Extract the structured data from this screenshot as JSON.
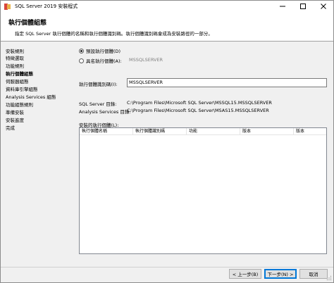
{
  "window": {
    "title": "SQL Server 2019 安裝程式",
    "minimize_symbol": "—",
    "maximize_symbol": "☐",
    "close_symbol": "✕"
  },
  "header": {
    "title": "執行個體組態",
    "description": "指定 SQL Server 執行個體的名稱和執行個體識別碼。執行個體識別碼會成為安裝路徑的一部分。"
  },
  "sidebar": {
    "items": [
      {
        "label": "安裝規則",
        "active": false
      },
      {
        "label": "特徵選取",
        "active": false
      },
      {
        "label": "功能規則",
        "active": false
      },
      {
        "label": "執行個體組態",
        "active": true
      },
      {
        "label": "伺服器組態",
        "active": false
      },
      {
        "label": "資料庫引擎組態",
        "active": false
      },
      {
        "label": "Analysis Services 組態",
        "active": false
      },
      {
        "label": "功能組態規則",
        "active": false
      },
      {
        "label": "準備安裝",
        "active": false
      },
      {
        "label": "安裝進度",
        "active": false
      },
      {
        "label": "完成",
        "active": false
      }
    ]
  },
  "instance": {
    "default_label": "預設執行個體(D)",
    "named_label": "具名執行個體(A):",
    "named_placeholder": "MSSQLSERVER",
    "selected": "default",
    "id_label": "執行個體識別碼(I):",
    "id_value": "MSSQLSERVER"
  },
  "paths": {
    "sql_label": "SQL Server 目錄:",
    "sql_value": "C:\\Program Files\\Microsoft SQL Server\\MSSQL15.MSSQLSERVER",
    "as_label": "Analysis Services 目錄:",
    "as_value": "C:\\Program Files\\Microsoft SQL Server\\MSAS15.MSSQLSERVER"
  },
  "installed": {
    "label": "安裝的執行個體(L):",
    "columns": [
      "執行個體名稱",
      "執行個體識別碼",
      "功能",
      "版本",
      "版本"
    ],
    "rows": []
  },
  "buttons": {
    "back": "< 上一步(B)",
    "next": "下一步(N) >",
    "cancel": "取消"
  },
  "icons": {
    "app": "sql-setup-icon",
    "minimize": "minimize-icon",
    "maximize": "maximize-icon",
    "close": "close-icon"
  }
}
